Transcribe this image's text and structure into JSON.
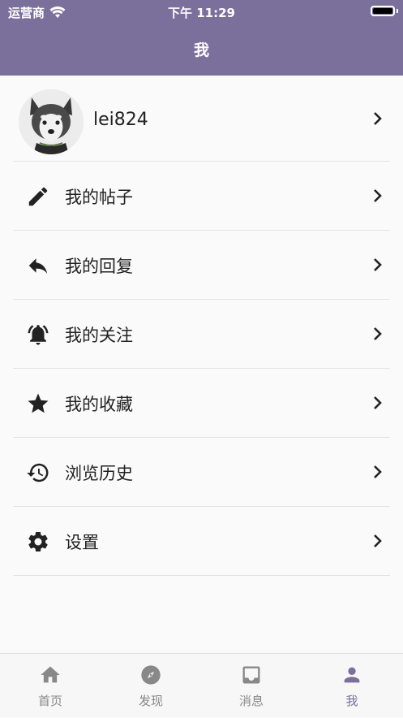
{
  "status_bar": {
    "carrier": "运营商",
    "time": "下午 11:29"
  },
  "header": {
    "title": "我"
  },
  "profile": {
    "username": "lei824"
  },
  "menu": {
    "items": [
      {
        "label": "我的帖子",
        "icon": "pencil-icon"
      },
      {
        "label": "我的回复",
        "icon": "reply-icon"
      },
      {
        "label": "我的关注",
        "icon": "bell-ring-icon"
      },
      {
        "label": "我的收藏",
        "icon": "star-icon"
      },
      {
        "label": "浏览历史",
        "icon": "history-icon"
      },
      {
        "label": "设置",
        "icon": "gear-icon"
      }
    ]
  },
  "tabbar": {
    "tabs": [
      {
        "label": "首页",
        "icon": "home-icon"
      },
      {
        "label": "发现",
        "icon": "compass-icon"
      },
      {
        "label": "消息",
        "icon": "inbox-icon"
      },
      {
        "label": "我",
        "icon": "person-icon",
        "active": true
      }
    ]
  },
  "colors": {
    "accent": "#7b6f9b",
    "icon": "#222222",
    "inactive_tab": "#888888"
  }
}
